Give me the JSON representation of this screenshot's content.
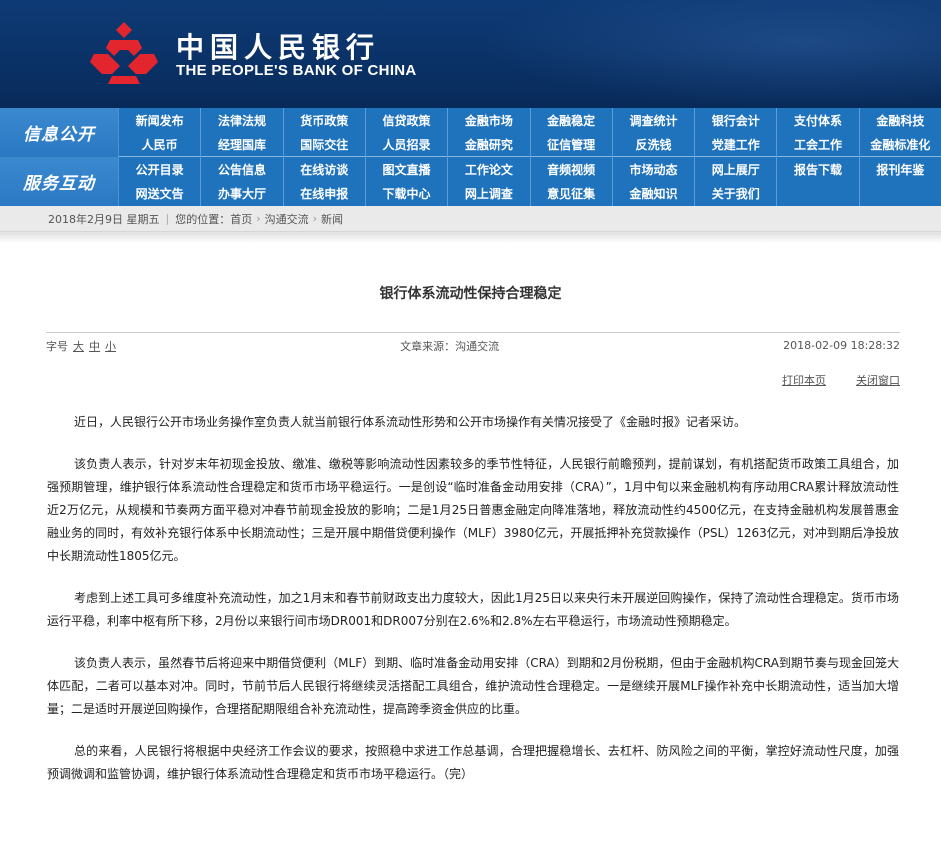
{
  "header": {
    "bank_name_cn": "中国人民银行",
    "bank_name_en": "THE PEOPLE'S BANK OF CHINA",
    "logo_color": "#e3262d"
  },
  "nav": {
    "sections": [
      {
        "title": "信息公开",
        "links": [
          "新闻发布",
          "法律法规",
          "货币政策",
          "信贷政策",
          "金融市场",
          "金融稳定",
          "调查统计",
          "银行会计",
          "支付体系",
          "金融科技",
          "人民币",
          "经理国库",
          "国际交往",
          "人员招录",
          "金融研究",
          "征信管理",
          "反洗钱",
          "党建工作",
          "工会工作",
          "金融标准化"
        ]
      },
      {
        "title": "服务互动",
        "links": [
          "公开目录",
          "公告信息",
          "在线访谈",
          "图文直播",
          "工作论文",
          "音频视频",
          "市场动态",
          "网上展厅",
          "报告下载",
          "报刊年鉴",
          "网送文告",
          "办事大厅",
          "在线申报",
          "下载中心",
          "网上调查",
          "意见征集",
          "金融知识",
          "关于我们",
          "",
          ""
        ]
      }
    ]
  },
  "breadcrumb": {
    "date": "2018年2月9日  星期五",
    "location_label": "您的位置：",
    "items": [
      "首页",
      "沟通交流",
      "新闻"
    ]
  },
  "article": {
    "title": "银行体系流动性保持合理稳定",
    "font_size_label": "字号",
    "size_large": "大",
    "size_medium": "中",
    "size_small": "小",
    "source": "文章来源：沟通交流",
    "datetime": "2018-02-09  18:28:32",
    "print_label": "打印本页",
    "close_label": "关闭窗口",
    "paragraphs": [
      "近日，人民银行公开市场业务操作室负责人就当前银行体系流动性形势和公开市场操作有关情况接受了《金融时报》记者采访。",
      "该负责人表示，针对岁末年初现金投放、缴准、缴税等影响流动性因素较多的季节性特征，人民银行前瞻预判，提前谋划，有机搭配货币政策工具组合，加强预期管理，维护银行体系流动性合理稳定和货币市场平稳运行。一是创设“临时准备金动用安排（CRA）”，1月中旬以来金融机构有序动用CRA累计释放流动性近2万亿元，从规模和节奏两方面平稳对冲春节前现金投放的影响；二是1月25日普惠金融定向降准落地，释放流动性约4500亿元，在支持金融机构发展普惠金融业务的同时，有效补充银行体系中长期流动性；三是开展中期借贷便利操作（MLF）3980亿元，开展抵押补充贷款操作（PSL）1263亿元，对冲到期后净投放中长期流动性1805亿元。",
      "考虑到上述工具可多维度补充流动性，加之1月末和春节前财政支出力度较大，因此1月25日以来央行未开展逆回购操作，保持了流动性合理稳定。货币市场运行平稳，利率中枢有所下移，2月份以来银行间市场DR001和DR007分别在2.6%和2.8%左右平稳运行，市场流动性预期稳定。",
      "该负责人表示，虽然春节后将迎来中期借贷便利（MLF）到期、临时准备金动用安排（CRA）到期和2月份税期，但由于金融机构CRA到期节奏与现金回笼大体匹配，二者可以基本对冲。同时，节前节后人民银行将继续灵活搭配工具组合，维护流动性合理稳定。一是继续开展MLF操作补充中长期流动性，适当加大增量；二是适时开展逆回购操作，合理搭配期限组合补充流动性，提高跨季资金供应的比重。",
      "总的来看，人民银行将根据中央经济工作会议的要求，按照稳中求进工作总基调，合理把握稳增长、去杠杆、防风险之间的平衡，掌控好流动性尺度，加强预调微调和监管协调，维护银行体系流动性合理稳定和货币市场平稳运行。（完）"
    ]
  }
}
